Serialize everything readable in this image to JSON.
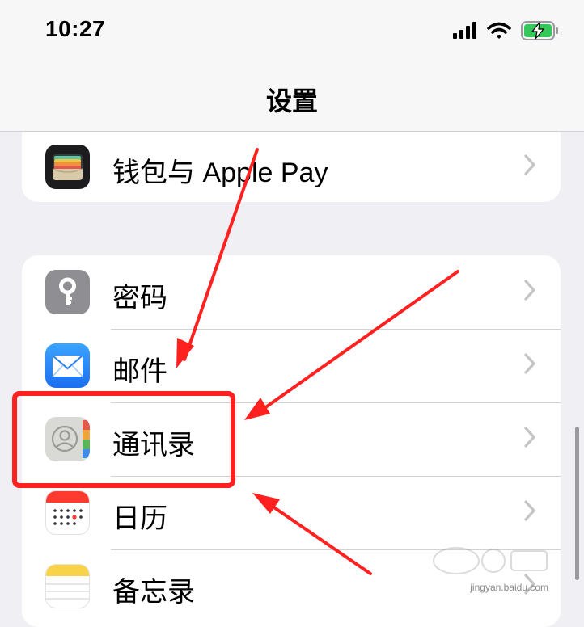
{
  "status_bar": {
    "time": "10:27",
    "battery": "charging",
    "signal": "4 bars",
    "wifi": "full"
  },
  "nav": {
    "title": "设置"
  },
  "group_1": [
    {
      "label": "钱包与 Apple Pay",
      "icon": "wallet-icon"
    }
  ],
  "group_2": [
    {
      "label": "密码",
      "icon": "key-icon"
    },
    {
      "label": "邮件",
      "icon": "mail-icon"
    },
    {
      "label": "通讯录",
      "icon": "contacts-icon"
    },
    {
      "label": "日历",
      "icon": "calendar-icon"
    },
    {
      "label": "备忘录",
      "icon": "notes-icon"
    }
  ],
  "annotations": {
    "highlight_color": "#ff2020"
  },
  "watermark": {
    "text": "jingyan.baidu.com",
    "logo": "Baidu 经验"
  }
}
